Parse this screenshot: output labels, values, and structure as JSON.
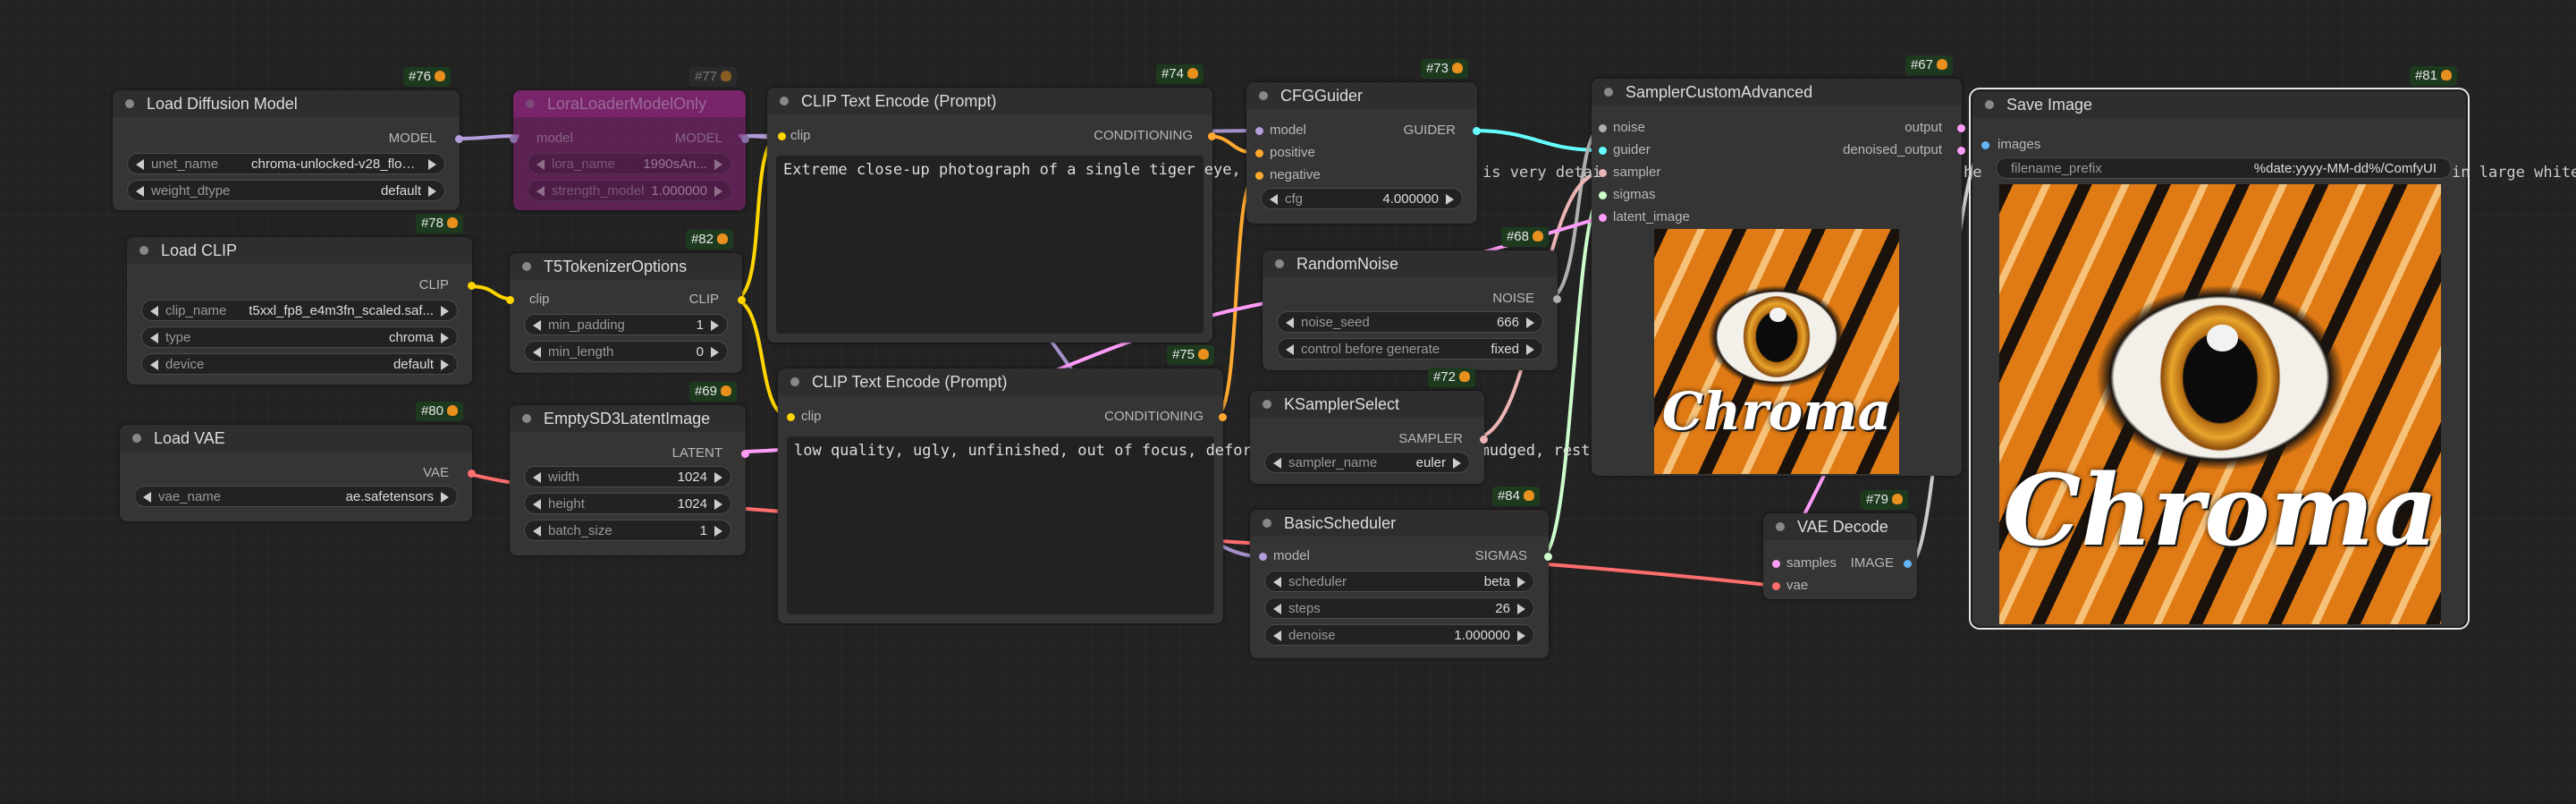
{
  "nodes": {
    "load_diffusion": {
      "badge": "#76",
      "title": "Load Diffusion Model",
      "output": "MODEL",
      "widgets": [
        {
          "label": "unet_name",
          "value": "chroma-unlocked-v28_float..."
        },
        {
          "label": "weight_dtype",
          "value": "default"
        }
      ]
    },
    "lora_loader": {
      "badge": "#77",
      "title": "LoraLoaderModelOnly",
      "input": "model",
      "output": "MODEL",
      "widgets": [
        {
          "label": "lora_name",
          "value": "1990sAn..."
        },
        {
          "label": "strength_model",
          "value": "1.000000"
        }
      ]
    },
    "load_clip": {
      "badge": "#78",
      "title": "Load CLIP",
      "output": "CLIP",
      "widgets": [
        {
          "label": "clip_name",
          "value": "t5xxl_fp8_e4m3fn_scaled.saf..."
        },
        {
          "label": "type",
          "value": "chroma"
        },
        {
          "label": "device",
          "value": "default"
        }
      ]
    },
    "t5_tokenizer": {
      "badge": "#82",
      "title": "T5TokenizerOptions",
      "input": "clip",
      "output": "CLIP",
      "widgets": [
        {
          "label": "min_padding",
          "value": "1"
        },
        {
          "label": "min_length",
          "value": "0"
        }
      ]
    },
    "load_vae": {
      "badge": "#80",
      "title": "Load VAE",
      "output": "VAE",
      "widgets": [
        {
          "label": "vae_name",
          "value": "ae.safetensors"
        }
      ]
    },
    "empty_latent": {
      "badge": "#69",
      "title": "EmptySD3LatentImage",
      "output": "LATENT",
      "widgets": [
        {
          "label": "width",
          "value": "1024"
        },
        {
          "label": "height",
          "value": "1024"
        },
        {
          "label": "batch_size",
          "value": "1"
        }
      ]
    },
    "clip_pos": {
      "badge": "#74",
      "title": "CLIP Text Encode (Prompt)",
      "input": "clip",
      "output": "CONDITIONING",
      "text": "Extreme close-up photograph of a single tiger eye, di"
    },
    "clip_neg": {
      "badge": "#75",
      "title": "CLIP Text Encode (Prompt)",
      "input": "clip",
      "output": "CONDITIONING",
      "text": "low quality, ugly, unfinished, out of focus, deformed, disfigure, blurry, smudged, restricted palette, flat colors"
    },
    "cfg_guider": {
      "badge": "#73",
      "title": "CFGGuider",
      "inputs": [
        "model",
        "positive",
        "negative"
      ],
      "output": "GUIDER",
      "widgets": [
        {
          "label": "cfg",
          "value": "4.000000"
        }
      ]
    },
    "random_noise": {
      "badge": "#68",
      "title": "RandomNoise",
      "output": "NOISE",
      "widgets": [
        {
          "label": "noise_seed",
          "value": "666"
        },
        {
          "label": "control before generate",
          "value": "fixed"
        }
      ]
    },
    "ksampler_select": {
      "badge": "#72",
      "title": "KSamplerSelect",
      "output": "SAMPLER",
      "widgets": [
        {
          "label": "sampler_name",
          "value": "euler"
        }
      ]
    },
    "basic_scheduler": {
      "badge": "#84",
      "title": "BasicScheduler",
      "input": "model",
      "output": "SIGMAS",
      "widgets": [
        {
          "label": "scheduler",
          "value": "beta"
        },
        {
          "label": "steps",
          "value": "26"
        },
        {
          "label": "denoise",
          "value": "1.000000"
        }
      ]
    },
    "sampler_custom": {
      "badge": "#67",
      "title": "SamplerCustomAdvanced",
      "inputs": [
        "noise",
        "guider",
        "sampler",
        "sigmas",
        "latent_image"
      ],
      "outputs": [
        "output",
        "denoised_output"
      ],
      "preview_text": "Chroma"
    },
    "vae_decode": {
      "badge": "#79",
      "title": "VAE Decode",
      "inputs": [
        "samples",
        "vae"
      ],
      "output": "IMAGE"
    },
    "save_image": {
      "badge": "#81",
      "title": "Save Image",
      "input": "images",
      "widgets": [
        {
          "label": "filename_prefix",
          "value": "%date:yyyy-MM-dd%/ComfyUI"
        }
      ],
      "preview_text": "Chroma"
    }
  },
  "overflow_text": {
    "prompt_mid": "is very detai",
    "prompt_he": "he",
    "prompt_tail": "in large white"
  },
  "colors": {
    "model": "#b39ddb",
    "clip": "#ffd500",
    "vae": "#ff6e6e",
    "latent": "#ff9cf9",
    "conditioning": "#ffa931",
    "guider": "#66ffff",
    "noise": "#b0b0b0",
    "sampler": "#ecb4b4",
    "sigmas": "#cdffcd",
    "image": "#64b5f6"
  }
}
